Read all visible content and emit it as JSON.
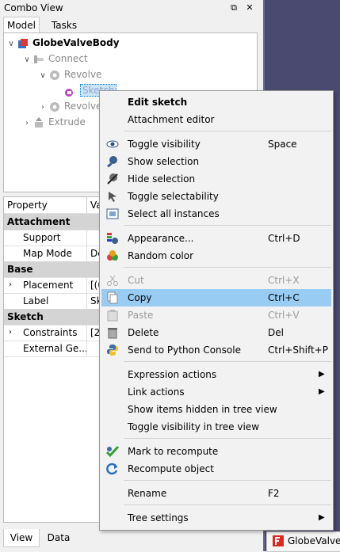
{
  "window": {
    "title": "Combo View",
    "float_icon": "⧉",
    "close_icon": "✕"
  },
  "tabs": [
    "Model",
    "Tasks"
  ],
  "tree": [
    {
      "label": "GlobeValveBody",
      "expanded": true
    },
    {
      "label": "Connect",
      "expanded": true
    },
    {
      "label": "Revolve",
      "expanded": true
    },
    {
      "label": "Sketch"
    },
    {
      "label": "Revolve"
    },
    {
      "label": "Extrude"
    }
  ],
  "props": {
    "header": [
      "Property",
      "Val"
    ],
    "rows": [
      {
        "type": "group",
        "k": "Attachment"
      },
      {
        "k": "Support",
        "v": ""
      },
      {
        "k": "Map Mode",
        "v": "Dea"
      },
      {
        "type": "group",
        "k": "Base"
      },
      {
        "k": "Placement",
        "v": "[(0.",
        "expand": true
      },
      {
        "k": "Label",
        "v": "Ske"
      },
      {
        "type": "group",
        "k": "Sketch"
      },
      {
        "k": "Constraints",
        "v": "[20",
        "expand": true
      },
      {
        "k": "External Ge...",
        "v": ""
      }
    ]
  },
  "bottom_tabs": [
    "View",
    "Data"
  ],
  "doc_tab": "GlobeValveBody",
  "menu": [
    {
      "label": "Edit sketch",
      "bold": true
    },
    {
      "label": "Attachment editor"
    },
    {
      "sep": true
    },
    {
      "label": "Toggle visibility",
      "shortcut": "Space",
      "icon": "eye-icon"
    },
    {
      "label": "Show selection",
      "icon": "magnifier-icon"
    },
    {
      "label": "Hide selection",
      "icon": "hide-icon"
    },
    {
      "label": "Toggle selectability",
      "icon": "cursor-icon"
    },
    {
      "label": "Select all instances",
      "icon": "select-all-icon"
    },
    {
      "sep": true
    },
    {
      "label": "Appearance...",
      "shortcut": "Ctrl+D",
      "icon": "appearance-icon"
    },
    {
      "label": "Random color",
      "icon": "color-icon"
    },
    {
      "sep": true
    },
    {
      "label": "Cut",
      "shortcut": "Ctrl+X",
      "icon": "scissors-icon",
      "disabled": true
    },
    {
      "label": "Copy",
      "shortcut": "Ctrl+C",
      "icon": "copy-icon",
      "highlight": true
    },
    {
      "label": "Paste",
      "shortcut": "Ctrl+V",
      "icon": "paste-icon",
      "disabled": true
    },
    {
      "label": "Delete",
      "shortcut": "Del",
      "icon": "delete-icon"
    },
    {
      "label": "Send to Python Console",
      "shortcut": "Ctrl+Shift+P",
      "icon": "python-icon"
    },
    {
      "sep": true
    },
    {
      "label": "Expression actions",
      "submenu": true
    },
    {
      "label": "Link actions",
      "submenu": true
    },
    {
      "label": "Show items hidden in tree view"
    },
    {
      "label": "Toggle visibility in tree view"
    },
    {
      "sep": true
    },
    {
      "label": "Mark to recompute",
      "icon": "mark-recompute-icon"
    },
    {
      "label": "Recompute object",
      "icon": "recompute-icon"
    },
    {
      "sep": true
    },
    {
      "label": "Rename",
      "shortcut": "F2"
    },
    {
      "sep": true
    },
    {
      "label": "Tree settings",
      "submenu": true
    }
  ]
}
